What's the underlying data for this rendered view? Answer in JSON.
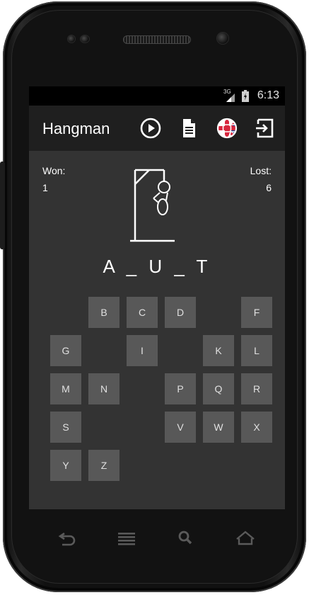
{
  "status_bar": {
    "time": "6:13",
    "network": "3G"
  },
  "action_bar": {
    "title": "Hangman",
    "icons": [
      "play-icon",
      "document-icon",
      "globe-flag-icon",
      "exit-icon"
    ]
  },
  "score": {
    "won_label": "Won:",
    "won_value": "1",
    "lost_label": "Lost:",
    "lost_value": "6"
  },
  "word": "A _ U _ T",
  "keyboard": {
    "keys": [
      {
        "letter": "B"
      },
      {
        "letter": "C"
      },
      {
        "letter": "D"
      },
      {
        "letter": "F"
      },
      {
        "letter": "G"
      },
      {
        "letter": "I"
      },
      {
        "letter": "K"
      },
      {
        "letter": "L"
      },
      {
        "letter": "M"
      },
      {
        "letter": "N"
      },
      {
        "letter": "P"
      },
      {
        "letter": "Q"
      },
      {
        "letter": "R"
      },
      {
        "letter": "S"
      },
      {
        "letter": "V"
      },
      {
        "letter": "W"
      },
      {
        "letter": "X"
      },
      {
        "letter": "Y"
      },
      {
        "letter": "Z"
      }
    ]
  },
  "colors": {
    "screen_bg": "#333333",
    "action_bar_bg": "#1f1f1f",
    "key_bg": "#585858",
    "text": "#ffffff"
  }
}
